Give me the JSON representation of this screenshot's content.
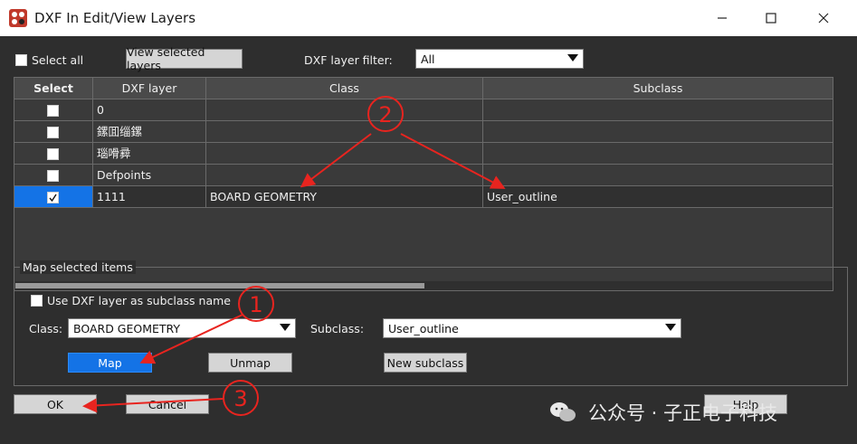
{
  "window": {
    "title": "DXF In Edit/View Layers",
    "controls": {
      "minimize": "—",
      "maximize": "☐",
      "close": "✕"
    }
  },
  "toolbar": {
    "select_all_label": "Select all",
    "view_selected_label": "View selected layers",
    "filter_label": "DXF layer filter:",
    "filter_value": "All"
  },
  "table": {
    "columns": [
      "Select",
      "DXF layer",
      "Class",
      "Subclass"
    ],
    "rows": [
      {
        "checked": false,
        "layer": "0",
        "class": "",
        "subclass": ""
      },
      {
        "checked": false,
        "layer": "鏍囬缁鏍",
        "class": "",
        "subclass": ""
      },
      {
        "checked": false,
        "layer": "瑙嗗彛",
        "class": "",
        "subclass": ""
      },
      {
        "checked": false,
        "layer": "Defpoints",
        "class": "",
        "subclass": ""
      },
      {
        "checked": true,
        "layer": "1111",
        "class": "BOARD GEOMETRY",
        "subclass": "User_outline"
      }
    ]
  },
  "map_group": {
    "title": "Map selected items",
    "use_dxf_label": "Use DXF layer as subclass name",
    "class_label": "Class:",
    "class_value": "BOARD GEOMETRY",
    "subclass_label": "Subclass:",
    "subclass_value": "User_outline",
    "map_label": "Map",
    "unmap_label": "Unmap",
    "new_subclass_label": "New subclass"
  },
  "footer": {
    "ok_label": "OK",
    "cancel_label": "Cancel",
    "help_label": "Help"
  },
  "annotations": {
    "n1": "1",
    "n2": "2",
    "n3": "3",
    "color": "#e8241f"
  },
  "watermark": {
    "text": "公众号 · 子正电子科技"
  },
  "colors": {
    "accent": "#1473e6",
    "panel": "#2e2e2e",
    "grid": "#3a3a3a"
  }
}
